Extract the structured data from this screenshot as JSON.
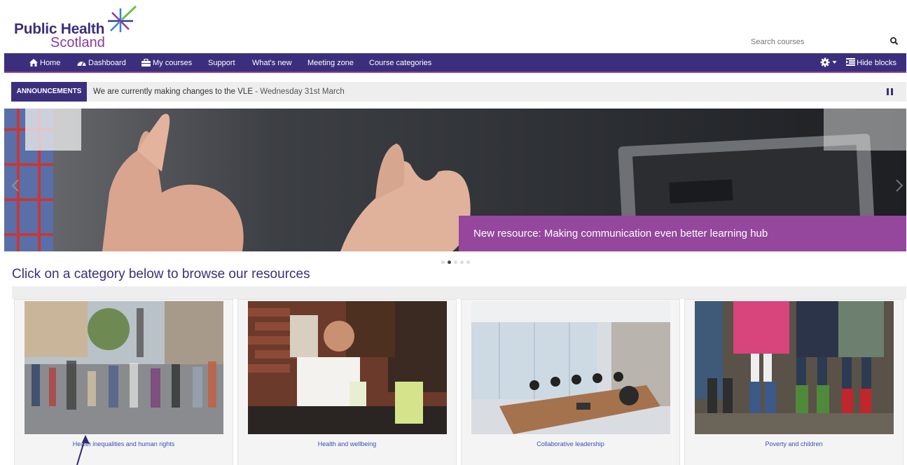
{
  "brand": {
    "line1": "Public Health",
    "line2": "Scotland"
  },
  "search": {
    "placeholder": "Search courses"
  },
  "nav": {
    "items": [
      {
        "label": "Home",
        "icon": "home-icon"
      },
      {
        "label": "Dashboard",
        "icon": "dashboard-icon"
      },
      {
        "label": "My courses",
        "icon": "briefcase-icon"
      },
      {
        "label": "Support"
      },
      {
        "label": "What's new"
      },
      {
        "label": "Meeting zone"
      },
      {
        "label": "Course categories"
      }
    ],
    "hide_blocks": "Hide blocks"
  },
  "announcements": {
    "tag": "ANNOUNCEMENTS",
    "headline": "We are currently making changes to the VLE",
    "date": " - Wednesday 31st March"
  },
  "carousel": {
    "caption": "New resource: Making communication even better learning hub",
    "slides": 5,
    "active_slide": 2
  },
  "page_title": "Click on a category below to browse our resources",
  "categories": [
    {
      "label": "Health inequalities and human rights"
    },
    {
      "label": "Health and wellbeing"
    },
    {
      "label": "Collaborative leadership"
    },
    {
      "label": "Poverty and children"
    }
  ],
  "colors": {
    "primary": "#3b2f7d",
    "accent": "#8a3a9c",
    "caption": "#94479c",
    "link": "#3b4fb3"
  }
}
